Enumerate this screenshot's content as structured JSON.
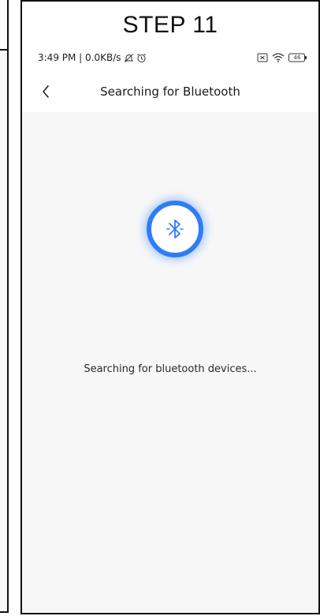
{
  "step_label": "STEP 11",
  "status_bar": {
    "time_info": "3:49 PM | 0.0KB/s",
    "battery_level": "46",
    "icons": [
      "mute-icon",
      "alarm-icon",
      "sim-icon",
      "wifi-icon",
      "battery-icon"
    ]
  },
  "nav": {
    "title": "Searching for Bluetooth",
    "back_icon": "chevron-left-icon"
  },
  "main": {
    "bluetooth_icon": "bluetooth-icon",
    "status_message": "Searching for bluetooth devices..."
  },
  "colors": {
    "accent": "#2f7df6",
    "content_bg": "#f7f7f8"
  }
}
